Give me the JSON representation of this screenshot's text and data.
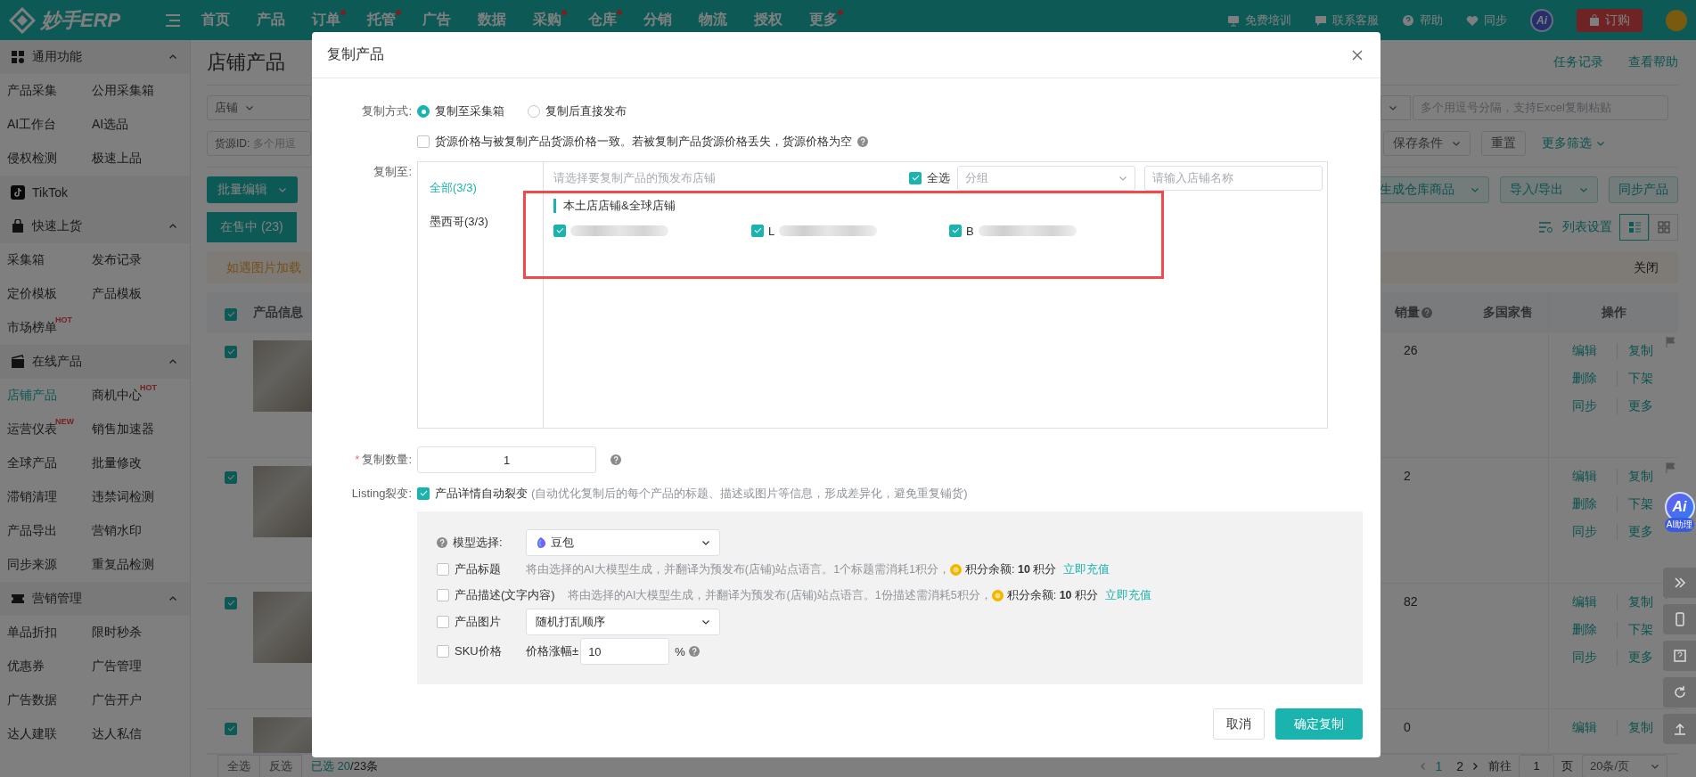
{
  "topbar": {
    "logo": "妙手ERP",
    "nav": [
      {
        "label": "首页",
        "badge": false
      },
      {
        "label": "产品",
        "badge": false
      },
      {
        "label": "订单",
        "badge": true
      },
      {
        "label": "托管",
        "badge": true
      },
      {
        "label": "广告",
        "badge": false
      },
      {
        "label": "数据",
        "badge": false
      },
      {
        "label": "采购",
        "badge": true
      },
      {
        "label": "仓库",
        "badge": true
      },
      {
        "label": "分销",
        "badge": false
      },
      {
        "label": "物流",
        "badge": false
      },
      {
        "label": "授权",
        "badge": false
      },
      {
        "label": "更多",
        "badge": true
      }
    ],
    "tools": [
      "免费培训",
      "联系客服",
      "帮助",
      "同步"
    ],
    "ai_label": "Ai",
    "order_button": "订购"
  },
  "sidebar": {
    "sections": [
      {
        "kind": "group",
        "title": "通用功能",
        "expanded": true,
        "items": [
          {
            "label": "产品采集",
            "selected": false
          },
          {
            "label": "公用采集箱",
            "selected": false
          },
          {
            "label": "AI工作台",
            "selected": false
          },
          {
            "label": "AI选品",
            "selected": false
          },
          {
            "label": "侵权检测",
            "selected": false
          },
          {
            "label": "极速上品",
            "selected": false
          }
        ]
      },
      {
        "kind": "platform",
        "title": "TikTok"
      },
      {
        "kind": "group",
        "title": "快速上货",
        "expanded": true,
        "items": [
          {
            "label": "采集箱",
            "selected": false
          },
          {
            "label": "发布记录",
            "selected": false
          },
          {
            "label": "定价模板",
            "selected": false
          },
          {
            "label": "产品模板",
            "selected": false
          },
          {
            "label": "市场榜单",
            "selected": false,
            "tag": "HOT"
          }
        ]
      },
      {
        "kind": "group",
        "title": "在线产品",
        "expanded": true,
        "items": [
          {
            "label": "店铺产品",
            "selected": true
          },
          {
            "label": "商机中心",
            "selected": false,
            "tag": "HOT"
          },
          {
            "label": "运营仪表",
            "selected": false,
            "tag": "NEW"
          },
          {
            "label": "销售加速器",
            "selected": false
          },
          {
            "label": "全球产品",
            "selected": false
          },
          {
            "label": "批量修改",
            "selected": false
          },
          {
            "label": "滞销清理",
            "selected": false
          },
          {
            "label": "违禁词检测",
            "selected": false
          },
          {
            "label": "产品导出",
            "selected": false
          },
          {
            "label": "营销水印",
            "selected": false
          },
          {
            "label": "同步来源",
            "selected": false
          },
          {
            "label": "重复品检测",
            "selected": false
          }
        ]
      },
      {
        "kind": "group",
        "title": "营销管理",
        "expanded": true,
        "items": [
          {
            "label": "单品折扣",
            "selected": false
          },
          {
            "label": "限时秒杀",
            "selected": false
          },
          {
            "label": "优惠券",
            "selected": false
          },
          {
            "label": "广告管理",
            "selected": false
          },
          {
            "label": "广告数据",
            "selected": false
          },
          {
            "label": "广告开户",
            "selected": false
          },
          {
            "label": "达人建联",
            "selected": false
          },
          {
            "label": "达人私信",
            "selected": false
          }
        ]
      }
    ]
  },
  "main": {
    "title": "店铺产品",
    "links": [
      "任务记录",
      "查看帮助"
    ],
    "store_select": "店铺",
    "source_id_label": "货源ID:",
    "source_id_placeholder": "多个用逗",
    "search_placeholder": "多个用逗号分隔，支持Excel复制粘贴",
    "save_filter": "保存条件",
    "reset": "重置",
    "more_filters": "更多筛选",
    "batch_edit": "批量编辑",
    "action_buttons": [
      {
        "label": "生成仓库商品",
        "dropdown": true
      },
      {
        "label": "导入/导出",
        "dropdown": true
      },
      {
        "label": "同步产品",
        "dropdown": false
      }
    ],
    "status_tabs": [
      {
        "label": "在售中 (23)",
        "selected": true
      }
    ],
    "list_settings": "列表设置",
    "view_modes": [
      {
        "kind": "list",
        "selected": true
      },
      {
        "kind": "grid",
        "selected": false
      }
    ],
    "notice": "如遇图片加载",
    "notice_close": "关闭",
    "table": {
      "header_checked": true,
      "columns": [
        "产品信息",
        "销量",
        "多国家售",
        "操作"
      ],
      "rows": [
        {
          "checked": true,
          "sales": "26",
          "actions": [
            "编辑",
            "复制",
            "删除",
            "下架",
            "同步",
            "更多"
          ]
        },
        {
          "checked": true,
          "sales": "2",
          "actions": [
            "编辑",
            "复制",
            "删除",
            "下架",
            "同步",
            "更多"
          ]
        },
        {
          "checked": true,
          "sales": "82",
          "actions": [
            "编辑",
            "复制",
            "删除",
            "下架",
            "同步",
            "更多"
          ]
        },
        {
          "checked": true,
          "sales": "0",
          "actions": [
            "编辑",
            "复制"
          ]
        }
      ]
    },
    "footer": {
      "select_all": "全选",
      "invert": "反选",
      "selected_label": "已选",
      "selected_count": "20",
      "total": "/23条",
      "pages": [
        {
          "label": "1",
          "selected": true
        },
        {
          "label": "2",
          "selected": false
        }
      ],
      "goto": "前往",
      "goto_value": "1",
      "page_unit": "页",
      "page_size": "20条/页"
    }
  },
  "side_tools": {
    "ai_badge": "Ai",
    "ai_label": "AI助理"
  },
  "dialog": {
    "title": "复制产品",
    "copy_mode": {
      "label": "复制方式:",
      "options": [
        {
          "label": "复制至采集箱",
          "selected": true
        },
        {
          "label": "复制后直接发布",
          "selected": false
        }
      ]
    },
    "same_price": {
      "label": "货源价格与被复制产品货源价格一致。若被复制产品货源价格丢失，货源价格为空",
      "checked": false
    },
    "copy_to": {
      "label": "复制至:",
      "regions": [
        {
          "label": "全部(3/3)",
          "selected": true
        },
        {
          "label": "墨西哥(3/3)",
          "selected": false
        }
      ],
      "hint": "请选择要复制产品的预发布店铺",
      "select_all": {
        "label": "全选",
        "checked": true
      },
      "group_placeholder": "分组",
      "search_placeholder": "请输入店铺名称",
      "group_title": "本土店店铺&全球店铺",
      "stores": [
        {
          "checked": true
        },
        {
          "initial": "L",
          "checked": true
        },
        {
          "initial": "B",
          "checked": true
        }
      ]
    },
    "quantity": {
      "label": "复制数量:",
      "required_mark": "*",
      "value": "1"
    },
    "listing": {
      "label": "Listing裂变:",
      "option": "产品详情自动裂变",
      "checked": true,
      "note": "(自动优化复制后的每个产品的标题、描述或图片等信息，形成差异化，避免重复铺货)"
    },
    "ai_panel": {
      "model_label": "模型选择:",
      "model_value": "豆包",
      "rows": [
        {
          "kind": "text",
          "label": "产品标题",
          "checked": false,
          "desc": "将由选择的AI大模型生成，并翻译为预发布(店铺)站点语言。1个标题需消耗1积分，",
          "balance": "积分余额: **10** 积分",
          "recharge": "立即充值"
        },
        {
          "kind": "text",
          "label": "产品描述(文字内容)",
          "checked": false,
          "desc": "将由选择的AI大模型生成，并翻译为预发布(店铺)站点语言。1份描述需消耗5积分，",
          "balance": "积分余额: **10** 积分",
          "recharge": "立即充值"
        },
        {
          "kind": "select",
          "label": "产品图片",
          "checked": false,
          "value": "随机打乱顺序"
        },
        {
          "kind": "percent",
          "label": "SKU价格",
          "checked": false,
          "prefix": "价格涨幅±",
          "value": "10",
          "suffix": "%"
        }
      ]
    },
    "buttons": [
      {
        "label": "取消",
        "kind": "secondary"
      },
      {
        "label": "确定复制",
        "kind": "primary"
      }
    ]
  }
}
